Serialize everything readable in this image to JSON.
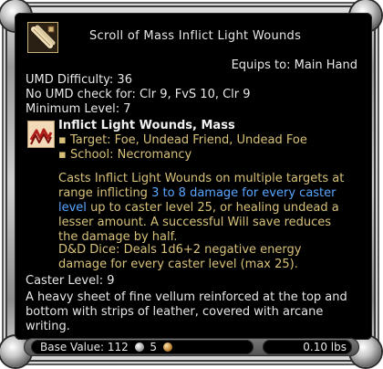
{
  "item": {
    "name": "Scroll of Mass Inflict Light Wounds",
    "equips_to": "Equips to: Main Hand",
    "umd_difficulty": "UMD Difficulty: 36",
    "no_umd_check": "No UMD check for: Clr 9, FvS 10, Clr 9",
    "minimum_level": "Minimum Level: 7"
  },
  "spell": {
    "name": "Inflict Light Wounds, Mass",
    "target": "Target: Foe, Undead Friend, Undead Foe",
    "school": "School: Necromancy",
    "desc_1": "Casts Inflict Light Wounds on multiple targets at range inflicting ",
    "desc_highlight": "3 to 8 damage for every caster level",
    "desc_2": " up to caster level 25, or healing undead a lesser amount. A successful Will save reduces the damage by half.",
    "dice": "D&D Dice: Deals 1d6+2 negative energy damage for every caster level (max 25)."
  },
  "caster_level": "Caster Level: 9",
  "flavor": "A heavy sheet of fine vellum reinforced at the top and bottom with strips of leather, covered with arcane writing.",
  "footer": {
    "base_value_label": "Base Value:",
    "silver": "112",
    "copper": "5",
    "weight": "0.10 lbs"
  },
  "icons": {
    "item_icon": "scroll-icon",
    "spell_icon": "inflict-wounds-icon",
    "silver_coin": "silver-coin-icon",
    "copper_coin": "copper-coin-icon"
  },
  "colors": {
    "background": "#000000",
    "primary_text": "#e6e6e6",
    "gold_text": "#d7c179",
    "highlight_blue": "#58a6ff"
  }
}
